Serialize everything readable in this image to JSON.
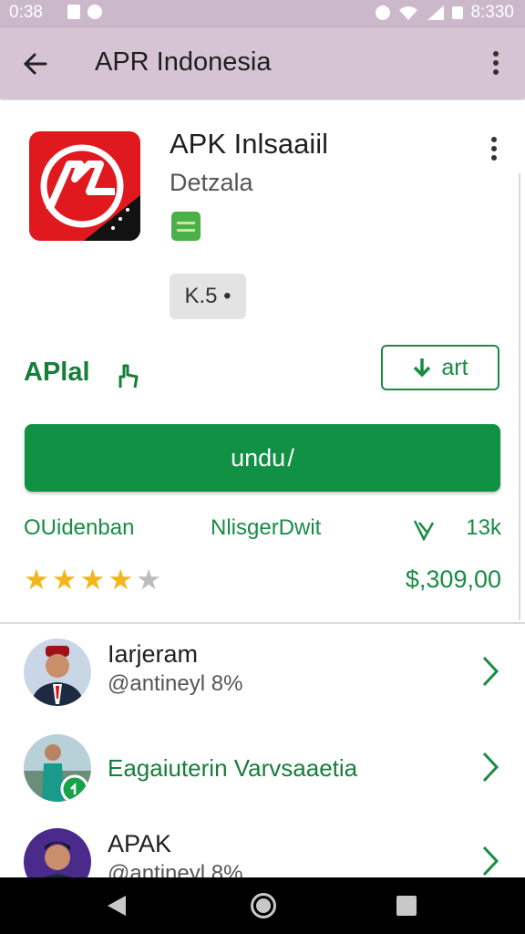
{
  "status_bar": {
    "time": "0:38",
    "right_time": "8:330"
  },
  "app_bar": {
    "title": "APR Indonesia"
  },
  "app": {
    "name": "APK Inlsaaiil",
    "developer": "Detzala",
    "rating_chip": "K.5 •",
    "category": "APlal",
    "wishlist_label": "art",
    "install_label": "undu /",
    "meta_left": "OUidenban",
    "meta_mid": "NlisgerDwit",
    "meta_size": "13k",
    "rating_stars": 4,
    "rating_max": 5,
    "price": "$,309,00"
  },
  "list": [
    {
      "title": "Iarjeram",
      "subtitle": "@antineyl 8%"
    },
    {
      "title": "Eagaiuterin Varvsaaetia",
      "subtitle": ""
    },
    {
      "title": "APAK",
      "subtitle": "@antineyl 8%"
    }
  ],
  "colors": {
    "accent": "#109143",
    "app_bar": "#d6c4d4",
    "star": "#f3b61a",
    "icon_red": "#e0191f"
  }
}
